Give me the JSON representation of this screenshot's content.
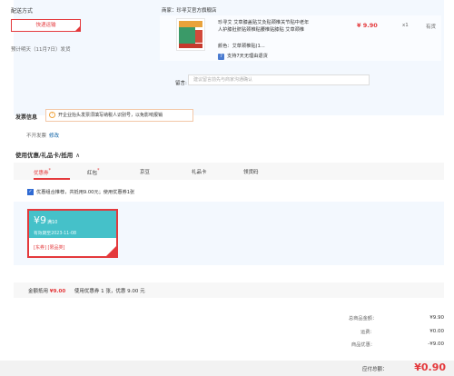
{
  "shipping": {
    "title": "配送方式",
    "method": "快递运输",
    "estimate": "预计明天（11月7日）发货"
  },
  "store": {
    "label": "商家：",
    "name": "珍寻艾官方旗舰店"
  },
  "item": {
    "name_line1": "珍寻艾 艾草膝盖贴艾灸贴颈椎关节贴中老年",
    "name_line2": "人护膝肚脐贴颈椎贴腰椎贴膝贴 艾草颈椎",
    "price": "¥ 9.90",
    "qty": "x1",
    "stock": "有货",
    "color": "颜色：艾草颈椎贴(1...",
    "return_badge": "7",
    "return_text": "支持7天无理由退货"
  },
  "note": {
    "label": "留言:",
    "placeholder": "建议留言前先与商家沟通确认"
  },
  "invoice": {
    "label": "发票信息",
    "tip": "开企业抬头发票须填写纳税人识别号，以免影响报销",
    "status": "不开发票",
    "edit": "修改"
  },
  "coupons": {
    "title": "使用优惠/礼品卡/抵用",
    "chevron": "∧",
    "tabs": [
      {
        "label": "优惠券",
        "mark": "*"
      },
      {
        "label": "红包",
        "mark": "*"
      },
      {
        "label": "京豆",
        "mark": ""
      },
      {
        "label": "礼品卡",
        "mark": ""
      },
      {
        "label": "领货码",
        "mark": ""
      }
    ],
    "combo_text": "优惠组合推荐，共抵用9.00元；使用优惠券1张",
    "card": {
      "amount": "¥9",
      "condition": "满10",
      "expiry": "有效期至2023-11-08",
      "tags": "[东券] [限品类]"
    }
  },
  "discount": {
    "label": "金额抵用",
    "amount": "¥9.00",
    "detail": "使用优惠券 1 张，优惠 9.00 元"
  },
  "summary": {
    "total_label": "总商品金额：",
    "total_value": "¥9.90",
    "shipping_label": "运费：",
    "shipping_value": "¥0.00",
    "discount_label": "商品优惠：",
    "discount_value": "-¥9.00"
  },
  "payment": {
    "label": "应付总额：",
    "amount": "¥0.90"
  },
  "colors": {
    "accent_red": "#e4393c",
    "panel_blue": "#f3f8fe",
    "coupon_teal": "#45c1c9"
  }
}
